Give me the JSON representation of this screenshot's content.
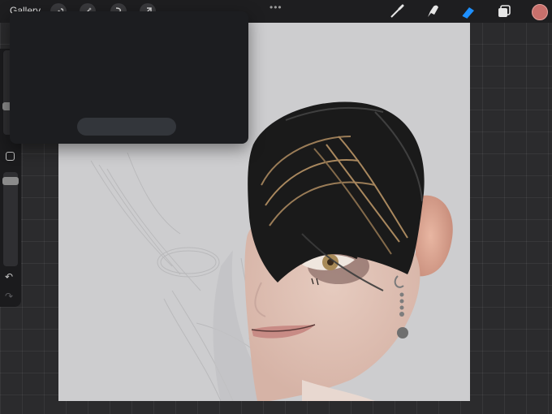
{
  "app": {
    "gallery_label": "Gallery"
  },
  "toolbar_left": {
    "icons": [
      "wrench-icon",
      "magic-wand-icon",
      "selection-icon",
      "transform-arrow-icon"
    ]
  },
  "toolbar_right": {
    "menu_dots": "•••",
    "icons": [
      "brush-icon",
      "smudge-icon",
      "eraser-icon",
      "layers-icon"
    ],
    "active_tool": "eraser-icon",
    "current_color": "#c8706c"
  },
  "sidebar": {
    "brush_size_level": 0.3,
    "opacity_level": 0.95,
    "undo_symbol": "↶",
    "redo_symbol": "↷"
  },
  "colors": {
    "accent": "#1e90ff",
    "canvas_bg": "#cdcdcf"
  }
}
